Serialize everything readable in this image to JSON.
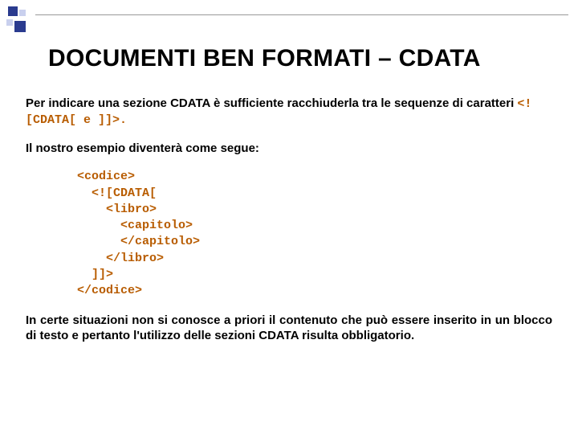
{
  "title": "DOCUMENTI BEN FORMATI – CDATA",
  "p1_a": "Per indicare una sezione CDATA è sufficiente racchiuderla tra le sequenze di caratteri ",
  "p1_code1": "<![CDATA[",
  "p1_b": " e ",
  "p1_code2": "]]>",
  "p1_c": ".",
  "p2": "Il nostro esempio diventerà come segue:",
  "code": "<codice>\n  <![CDATA[\n    <libro>\n      <capitolo>\n      </capitolo>\n    </libro>\n  ]]>\n</codice>",
  "p3": "In certe situazioni non si conosce a priori il contenuto che può essere inserito in un blocco di testo e pertanto l'utilizzo delle sezioni CDATA risulta obbligatorio."
}
